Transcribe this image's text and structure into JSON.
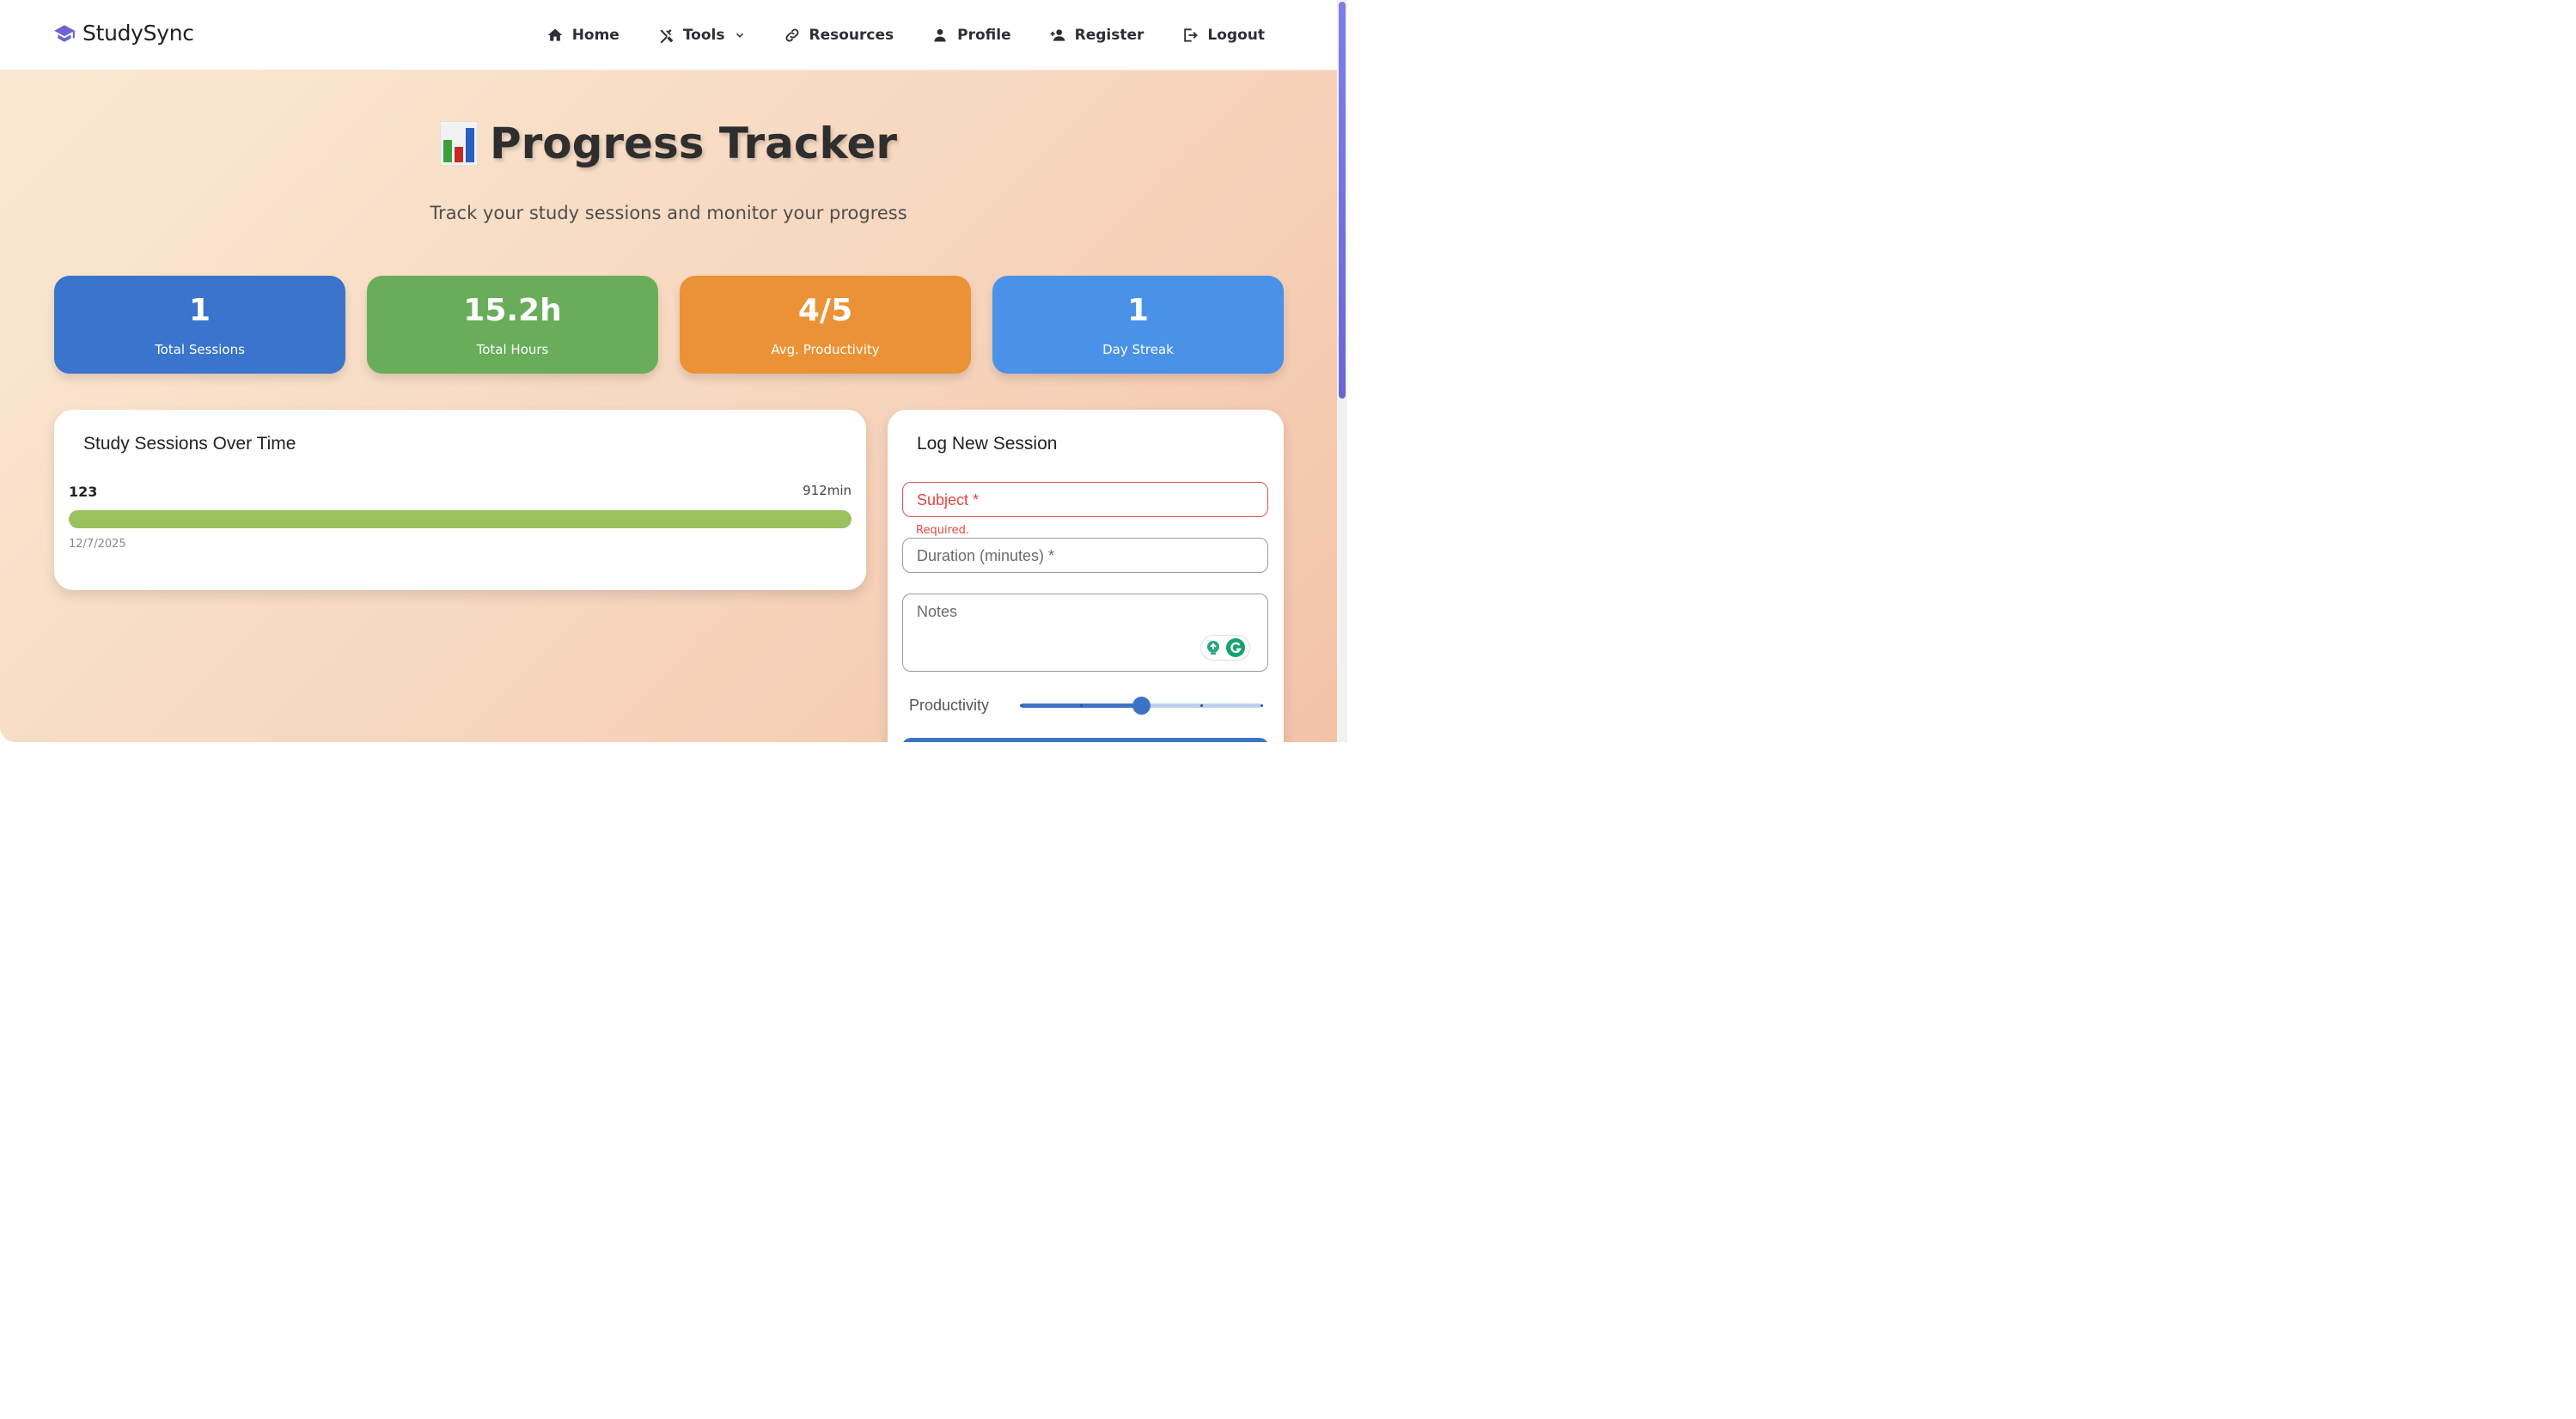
{
  "brand": {
    "name": "StudySync"
  },
  "nav": {
    "items": [
      {
        "label": "Home",
        "icon": "home-icon"
      },
      {
        "label": "Tools",
        "icon": "tools-icon",
        "has_dropdown": true
      },
      {
        "label": "Resources",
        "icon": "link-icon"
      },
      {
        "label": "Profile",
        "icon": "user-icon"
      },
      {
        "label": "Register",
        "icon": "user-plus-icon"
      },
      {
        "label": "Logout",
        "icon": "logout-icon"
      }
    ]
  },
  "page": {
    "title": "Progress Tracker",
    "title_icon": "bar-chart-emoji-icon",
    "subtitle": "Track your study sessions and monitor your progress"
  },
  "stats": [
    {
      "value": "1",
      "label": "Total Sessions",
      "color": "#3a74cc"
    },
    {
      "value": "15.2h",
      "label": "Total Hours",
      "color": "#69ad5a"
    },
    {
      "value": "4/5",
      "label": "Avg. Productivity",
      "color": "#ec9236"
    },
    {
      "value": "1",
      "label": "Day Streak",
      "color": "#4a92e8"
    }
  ],
  "sessions_panel": {
    "title": "Study Sessions Over Time",
    "sessions": [
      {
        "subject": "123",
        "duration": "912min",
        "date": "12/7/2025",
        "fill_fraction": 1.0,
        "color": "#9bc15d"
      }
    ]
  },
  "log_panel": {
    "title": "Log New Session",
    "subject_placeholder": "Subject *",
    "subject_error": "Required.",
    "duration_placeholder": "Duration (minutes) *",
    "notes_placeholder": "Notes",
    "productivity_label": "Productivity",
    "productivity_value": 3,
    "productivity_max": 5
  },
  "colors": {
    "accent": "#3d73c6",
    "error": "#e0463f",
    "brand_icon": "#6b63d6"
  }
}
